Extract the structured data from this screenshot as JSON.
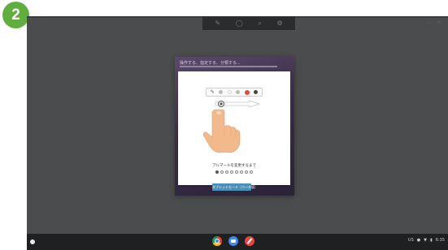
{
  "step": {
    "number": "2"
  },
  "dialog": {
    "bg_title": "操作する、指定する、分類する...",
    "caption": "ブルマールを変更するまで",
    "pages": {
      "total": 8,
      "current": 1
    },
    "next_label": "タブレットモード（ベータ版）"
  },
  "topbar": {
    "icons": [
      "pen-icon",
      "circle-icon",
      "search-icon",
      "settings-icon"
    ]
  },
  "shelf": {
    "apps": [
      "chrome-icon",
      "files-icon",
      "pen-app-icon"
    ],
    "status": {
      "ime": "US",
      "time": "6:35"
    }
  },
  "colors": {
    "badge": "#5fae3e",
    "accent": "#4a90b8",
    "red": "#e24a3a"
  }
}
